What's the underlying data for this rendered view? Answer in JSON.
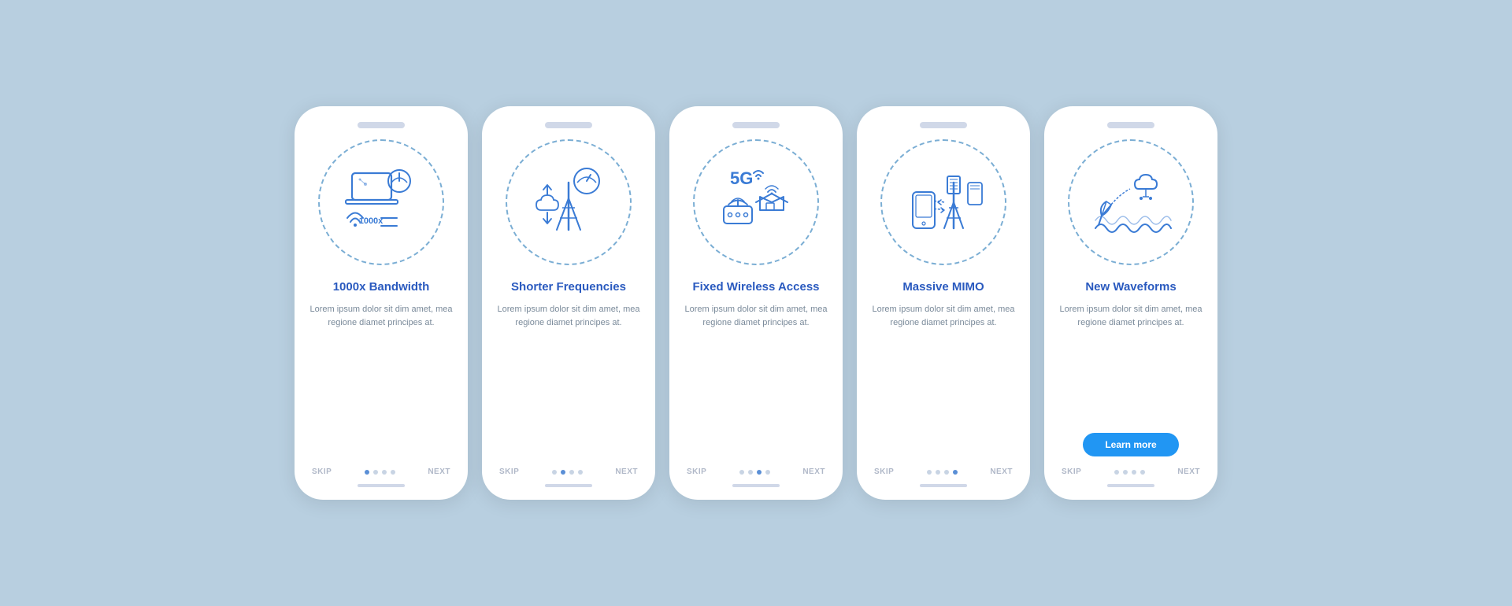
{
  "background": "#b8cfe0",
  "phones": [
    {
      "id": "bandwidth",
      "title": "1000x Bandwidth",
      "body": "Lorem ipsum dolor sit dim amet, mea regione diamet principes at.",
      "skip_label": "SKIP",
      "next_label": "NEXT",
      "dots": [
        true,
        false,
        false,
        false
      ],
      "show_learn_more": false,
      "learn_more_label": ""
    },
    {
      "id": "frequencies",
      "title": "Shorter Frequencies",
      "body": "Lorem ipsum dolor sit dim amet, mea regione diamet principes at.",
      "skip_label": "SKIP",
      "next_label": "NEXT",
      "dots": [
        false,
        true,
        false,
        false
      ],
      "show_learn_more": false,
      "learn_more_label": ""
    },
    {
      "id": "wireless",
      "title": "Fixed Wireless Access",
      "body": "Lorem ipsum dolor sit dim amet, mea regione diamet principes at.",
      "skip_label": "SKIP",
      "next_label": "NEXT",
      "dots": [
        false,
        false,
        true,
        false
      ],
      "show_learn_more": false,
      "learn_more_label": ""
    },
    {
      "id": "mimo",
      "title": "Massive MIMO",
      "body": "Lorem ipsum dolor sit dim amet, mea regione diamet principes at.",
      "skip_label": "SKIP",
      "next_label": "NEXT",
      "dots": [
        false,
        false,
        false,
        true
      ],
      "show_learn_more": false,
      "learn_more_label": ""
    },
    {
      "id": "waveforms",
      "title": "New Waveforms",
      "body": "Lorem ipsum dolor sit dim amet, mea regione diamet principes at.",
      "skip_label": "SKIP",
      "next_label": "NEXT",
      "dots": [
        false,
        false,
        false,
        false
      ],
      "show_learn_more": true,
      "learn_more_label": "Learn more"
    }
  ]
}
